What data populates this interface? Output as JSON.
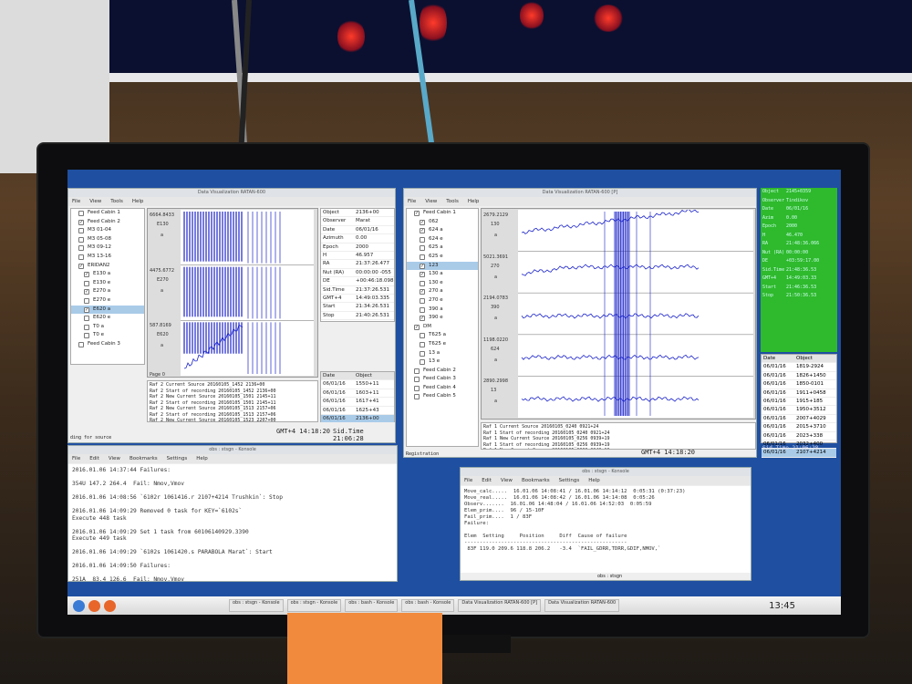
{
  "left_app": {
    "title": "Data Visualization RATAN-600",
    "menu": [
      "File",
      "View",
      "Tools",
      "Help"
    ],
    "tree": [
      {
        "label": "Feed Cabin 1",
        "level": 0,
        "checked": false
      },
      {
        "label": "Feed Cabin 2",
        "level": 0,
        "checked": true
      },
      {
        "label": "M3 01-04",
        "level": 0,
        "checked": false
      },
      {
        "label": "M3 05-08",
        "level": 0,
        "checked": false
      },
      {
        "label": "M3 09-12",
        "level": 0,
        "checked": false
      },
      {
        "label": "M3 13-16",
        "level": 0,
        "checked": false
      },
      {
        "label": "ERIDAN2",
        "level": 0,
        "checked": true
      },
      {
        "label": "E130 a",
        "level": 1,
        "checked": true
      },
      {
        "label": "E130 e",
        "level": 1,
        "checked": false
      },
      {
        "label": "E270 a",
        "level": 1,
        "checked": true
      },
      {
        "label": "E270 e",
        "level": 1,
        "checked": false
      },
      {
        "label": "E620 a",
        "level": 1,
        "checked": true,
        "selected": true
      },
      {
        "label": "E620 e",
        "level": 1,
        "checked": false
      },
      {
        "label": "T0 a",
        "level": 1,
        "checked": false
      },
      {
        "label": "T0 e",
        "level": 1,
        "checked": false
      },
      {
        "label": "Feed Cabin 3",
        "level": 0,
        "checked": false
      }
    ],
    "channels": [
      {
        "top": "6664.8433",
        "name": "E130",
        "pol": "a"
      },
      {
        "top": "4475.6772",
        "name": "E270",
        "pol": "a"
      },
      {
        "top": "587.8169",
        "name": "E620",
        "pol": "a"
      }
    ],
    "page_label": "Page 0",
    "info": [
      {
        "k": "Object",
        "v": "2136+00"
      },
      {
        "k": "Observer",
        "v": "Marat"
      },
      {
        "k": "Date",
        "v": "06/01/16"
      },
      {
        "k": "Azimuth",
        "v": "0.00"
      },
      {
        "k": "Epoch",
        "v": "2000"
      },
      {
        "k": "H",
        "v": "46.957"
      },
      {
        "k": "RA",
        "v": "21:37:26.477"
      },
      {
        "k": "Nut (RA)",
        "v": "00:00:00 -055"
      },
      {
        "k": "DE",
        "v": "+00:46:18.098"
      },
      {
        "k": "Sid.Time",
        "v": "21:37:26.531"
      },
      {
        "k": "GMT+4",
        "v": "14:49:03.335"
      },
      {
        "k": "Start",
        "v": "21:34:26.531"
      },
      {
        "k": "Stop",
        "v": "21:40:26.531"
      }
    ],
    "schedule_header": [
      "Date",
      "Object"
    ],
    "schedule": [
      [
        "06/01/16",
        "1550+11"
      ],
      [
        "06/01/16",
        "1603+11"
      ],
      [
        "06/01/16",
        "1617+41"
      ],
      [
        "06/01/16",
        "1625+43"
      ],
      [
        "06/01/16",
        "2136+00"
      ]
    ],
    "log": [
      "Raf 2 Current Source 20160105_1452 2136+00",
      "Raf 2 Start of recording 20160105_1452 2136+00",
      "Raf 2 New Current Source 20160105_1501 2145+11",
      "Raf 2 Start of recording 20160105_1501 2145+11",
      "Raf 2 New Current Source 20160105_1513 2157+06",
      "Raf 2 Start of recording 20160105_1513 2157+06",
      "Raf 2 New Current Source 20160105_1523 2207+00"
    ],
    "gmt": "GMT+4 14:18:20",
    "sid": "Sid.Time 21:06:28",
    "status_left": "ding for source"
  },
  "right_app": {
    "title": "Data Visualization RATAN-600 [P]",
    "menu": [
      "File",
      "View",
      "Tools",
      "Help"
    ],
    "tree": [
      {
        "label": "Feed Cabin 1",
        "level": 0,
        "checked": true
      },
      {
        "label": "062",
        "level": 1,
        "checked": true
      },
      {
        "label": "624 a",
        "level": 1,
        "checked": true
      },
      {
        "label": "624 e",
        "level": 1,
        "checked": false
      },
      {
        "label": "625 a",
        "level": 1,
        "checked": false
      },
      {
        "label": "625 e",
        "level": 1,
        "checked": false
      },
      {
        "label": "123",
        "level": 1,
        "checked": true,
        "selected": true
      },
      {
        "label": "130 a",
        "level": 1,
        "checked": true
      },
      {
        "label": "130 e",
        "level": 1,
        "checked": false
      },
      {
        "label": "270 a",
        "level": 1,
        "checked": true
      },
      {
        "label": "270 e",
        "level": 1,
        "checked": false
      },
      {
        "label": "390 a",
        "level": 1,
        "checked": false
      },
      {
        "label": "390 e",
        "level": 1,
        "checked": true
      },
      {
        "label": "DM",
        "level": 0,
        "checked": true
      },
      {
        "label": "T625 a",
        "level": 1,
        "checked": false
      },
      {
        "label": "T625 e",
        "level": 1,
        "checked": false
      },
      {
        "label": "13 a",
        "level": 1,
        "checked": false
      },
      {
        "label": "13 e",
        "level": 1,
        "checked": false
      },
      {
        "label": "Feed Cabin 2",
        "level": 0,
        "checked": false
      },
      {
        "label": "Feed Cabin 3",
        "level": 0,
        "checked": false
      },
      {
        "label": "Feed Cabin 4",
        "level": 0,
        "checked": false
      },
      {
        "label": "Feed Cabin 5",
        "level": 0,
        "checked": false
      }
    ],
    "channels": [
      {
        "top": "2679.2129",
        "name": "130",
        "pol": "a"
      },
      {
        "top": "5021.3691",
        "name": "270",
        "pol": "a"
      },
      {
        "top": "2194.0783",
        "name": "390",
        "pol": "a"
      },
      {
        "top": "1198.0220",
        "name": "624",
        "pol": "a"
      },
      {
        "top": "2890.2998",
        "name": "13",
        "pol": "a"
      }
    ],
    "page_label": "Page 0",
    "log": [
      "Raf 1 Current Source 20160105_0240 0921+24",
      "Raf 1 Start of recording 20160105_0240 0921+24",
      "Raf 1 New Current Source 20160105_0256 0939+19",
      "Raf 1 Start of recording 20160105_0256 0939+19",
      "Raf 1 New Current Source 20160105_0303 0943+19",
      "Raf 1 Start of recording 20160105_0303 0943+19",
      "Raf 1 New Current Source 20160105_0311 0953+19"
    ],
    "gmt": "GMT+4 14:18:20",
    "sid": "Sid.Time 21:06:28",
    "status_left": "Registration",
    "green_info": [
      {
        "k": "Object",
        "v": "2145+0359"
      },
      {
        "k": "Observer",
        "v": "Tindikov"
      },
      {
        "k": "Date",
        "v": "06/01/16"
      },
      {
        "k": "Azim",
        "v": "0.00"
      },
      {
        "k": "Epoch",
        "v": "2000"
      },
      {
        "k": "H",
        "v": "46.470"
      },
      {
        "k": "RA",
        "v": "21:48:36.066"
      },
      {
        "k": "Nut (RA)",
        "v": "00:00:00"
      },
      {
        "k": "DE",
        "v": "+03:59:17.00"
      },
      {
        "k": "Sid.Time",
        "v": "21:48:36.53"
      },
      {
        "k": "GMT+4",
        "v": "14:49:03.33"
      },
      {
        "k": "Start",
        "v": "21:46:36.53"
      },
      {
        "k": "Stop",
        "v": "21:50:36.53"
      }
    ],
    "schedule_header": [
      "Date",
      "Object"
    ],
    "schedule": [
      [
        "06/01/16",
        "1819-2924"
      ],
      [
        "06/01/16",
        "1826+1450"
      ],
      [
        "06/01/16",
        "1850-0101"
      ],
      [
        "06/01/16",
        "1911+0458"
      ],
      [
        "06/01/16",
        "1915+185"
      ],
      [
        "06/01/16",
        "1950+3512"
      ],
      [
        "06/01/16",
        "2007+4029"
      ],
      [
        "06/01/16",
        "2015+3710"
      ],
      [
        "06/01/16",
        "2023+338"
      ],
      [
        "06/01/16",
        "2032+400"
      ],
      [
        "06/01/16",
        "2107+4214"
      ]
    ]
  },
  "konsole_left": {
    "title": "obs : stsgn - Konsole",
    "menu": [
      "File",
      "Edit",
      "View",
      "Bookmarks",
      "Settings",
      "Help"
    ],
    "lines": [
      "2016.01.06 14:37:44 Failures:",
      "",
      "354U 147.2 264.4  Fail: Nmov,Vmov",
      "",
      "2016.01.06 14:08:56 `6102r 1061416.r 2107+4214 Trushkin`: Stop",
      "",
      "2016.01.06 14:09:29 Removed 0 task for KEY=`6102s`",
      "Execute 448 task",
      "",
      "2016.01.06 14:09:29 Set 1 task from 60106140929.3390",
      "Execute 449 task",
      "",
      "2016.01.06 14:09:29 `6102s 1061420.s PARABOLA Marat`: Start",
      "",
      "2016.01.06 14:09:50 Failures:",
      "",
      "251A  83.4 126.6  Fail: Nmov,Vmov"
    ],
    "tab": "obs : stsgn"
  },
  "konsole_right": {
    "title": "obs : stsgn - Konsole",
    "menu": [
      "File",
      "Edit",
      "View",
      "Bookmarks",
      "Settings",
      "Help"
    ],
    "lines": [
      "Move_calc.....  16.01.06 14:08:41 / 16.01.06 14:14:12  0:05:31 (0:37:23)",
      "Move_real.....  16.01.06 14:08:42 / 16.01.06 14:14:08  0:05:26",
      "Observ.......  16.01.06 14:48:04 / 16.01.06 14:52:03  0:05:59",
      "Elem_prim....  96 / 15-10F",
      "Fail_prim....  1 / 83F",
      "Failure:",
      "",
      "Elem  Setting     Position     Diff  Cause of failure",
      "-----------------------------------------------------",
      " 83F 119.0 209.6 118.8 206.2   -3.4  `FAIL_GDRR,TDRR,GDIF,NMOV,`"
    ],
    "tab": "obs : stsgn"
  },
  "taskbar": {
    "tasks": [
      "obs : stsgn - Konsole",
      "obs : stsgn - Konsole",
      "obs : bash - Konsole",
      "obs : bash - Konsole",
      "Data Visualization RATAN-600 [P]",
      "Data Visualization RATAN-600"
    ],
    "clock": "13:45"
  }
}
